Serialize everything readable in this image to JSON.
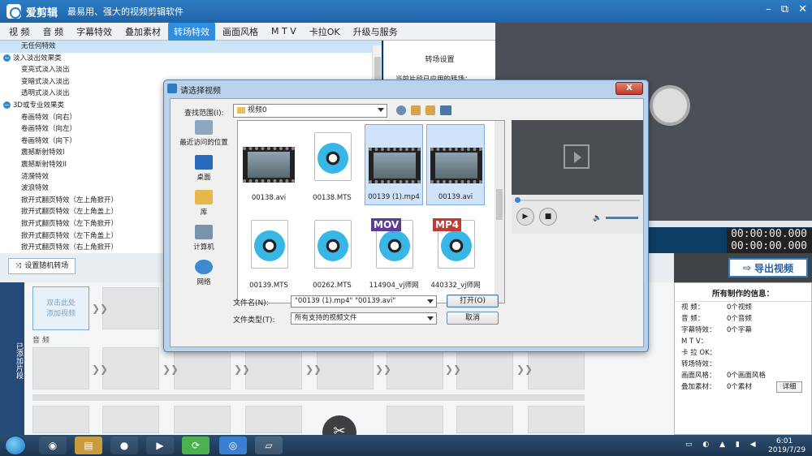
{
  "app": {
    "title": "爱剪辑",
    "slogan": "最易用、强大的视频剪辑软件",
    "controls": [
      "–",
      "⧉",
      "✕"
    ]
  },
  "tabs": [
    {
      "label": "视  频",
      "active": false
    },
    {
      "label": "音  频",
      "active": false
    },
    {
      "label": "字幕特效",
      "active": false
    },
    {
      "label": "叠加素材",
      "active": false
    },
    {
      "label": "转场特效",
      "active": true
    },
    {
      "label": "画面风格",
      "active": false
    },
    {
      "label": "M T V",
      "active": false
    },
    {
      "label": "卡拉OK",
      "active": false
    },
    {
      "label": "升级与服务",
      "active": false
    }
  ],
  "effects": [
    {
      "label": "无任何特效",
      "type": "item",
      "selected": true
    },
    {
      "label": "淡入淡出效果类",
      "type": "group"
    },
    {
      "label": "变亮式淡入淡出",
      "type": "item"
    },
    {
      "label": "变暗式淡入淡出",
      "type": "item"
    },
    {
      "label": "透明式淡入淡出",
      "type": "item"
    },
    {
      "label": "3D或专业效果类",
      "type": "group"
    },
    {
      "label": "卷画特效（向右）",
      "type": "item"
    },
    {
      "label": "卷画特效（向左）",
      "type": "item"
    },
    {
      "label": "卷画特效（向下）",
      "type": "item"
    },
    {
      "label": "震撼斯射特效I",
      "type": "item"
    },
    {
      "label": "震撼斯射特效II",
      "type": "item"
    },
    {
      "label": "涟漪特效",
      "type": "item"
    },
    {
      "label": "波浪特效",
      "type": "item"
    },
    {
      "label": "掀开式翻页特效（左上角掀开）",
      "type": "item"
    },
    {
      "label": "掀开式翻页特效（左上角盖上）",
      "type": "item"
    },
    {
      "label": "掀开式翻页特效（左下角掀开）",
      "type": "item"
    },
    {
      "label": "掀开式翻页特效（左下角盖上）",
      "type": "item"
    },
    {
      "label": "掀开式翻页特效（右上角掀开）",
      "type": "item"
    }
  ],
  "settings": {
    "title": "转场设置",
    "applied_label": "当前片段已应用的转场："
  },
  "preview": {
    "time1": "00:00:00.000",
    "time2": "00:00:00.000"
  },
  "toolbar": {
    "random_label": "设置随机转场",
    "export_label": "导出视频"
  },
  "timeline": {
    "side_label": "已添加片段",
    "add_label": "双击此处\n添加视频",
    "audio_label": "音  频"
  },
  "info": {
    "title": "所有制作的信息：",
    "rows": [
      {
        "key": "视    频：",
        "value": "0个视频"
      },
      {
        "key": "音    频：",
        "value": "0个音频"
      },
      {
        "key": "字幕特效：",
        "value": "0个字幕"
      },
      {
        "key": "M   T   V：",
        "value": ""
      },
      {
        "key": "卡 拉 OK：",
        "value": ""
      },
      {
        "key": "转场特效：",
        "value": ""
      },
      {
        "key": "画面风格：",
        "value": "0个画面风格"
      },
      {
        "key": "叠加素材：",
        "value": "0个素材"
      }
    ],
    "detail_label": "详细"
  },
  "dialog": {
    "title": "请选择视频",
    "close_label": "X",
    "lookin_label": "查找范围(I):",
    "lookin_value": "视频0",
    "places": [
      "最近访问的位置",
      "桌面",
      "库",
      "计算机",
      "网络"
    ],
    "files": [
      {
        "name": "00138.avi",
        "kind": "film",
        "selected": false
      },
      {
        "name": "00138.MTS",
        "kind": "doc",
        "selected": false
      },
      {
        "name": "00139 (1).mp4",
        "kind": "film",
        "selected": true
      },
      {
        "name": "00139.avi",
        "kind": "film",
        "selected": true
      },
      {
        "name": "00139.MTS",
        "kind": "doc",
        "selected": false
      },
      {
        "name": "00262.MTS",
        "kind": "doc",
        "selected": false
      },
      {
        "name": "114904_vj师网",
        "kind": "mov",
        "tag": "MOV",
        "selected": false
      },
      {
        "name": "440332_vj师网",
        "kind": "mp4",
        "tag": "MP4",
        "selected": false
      }
    ],
    "filename_label": "文件名(N):",
    "filename_value": "\"00139 (1).mp4\" \"00139.avi\"",
    "filetype_label": "文件类型(T):",
    "filetype_value": "所有支持的视频文件",
    "open_label": "打开(O)",
    "cancel_label": "取消"
  },
  "taskbar": {
    "time": "6:01",
    "date": "2019/7/29"
  }
}
